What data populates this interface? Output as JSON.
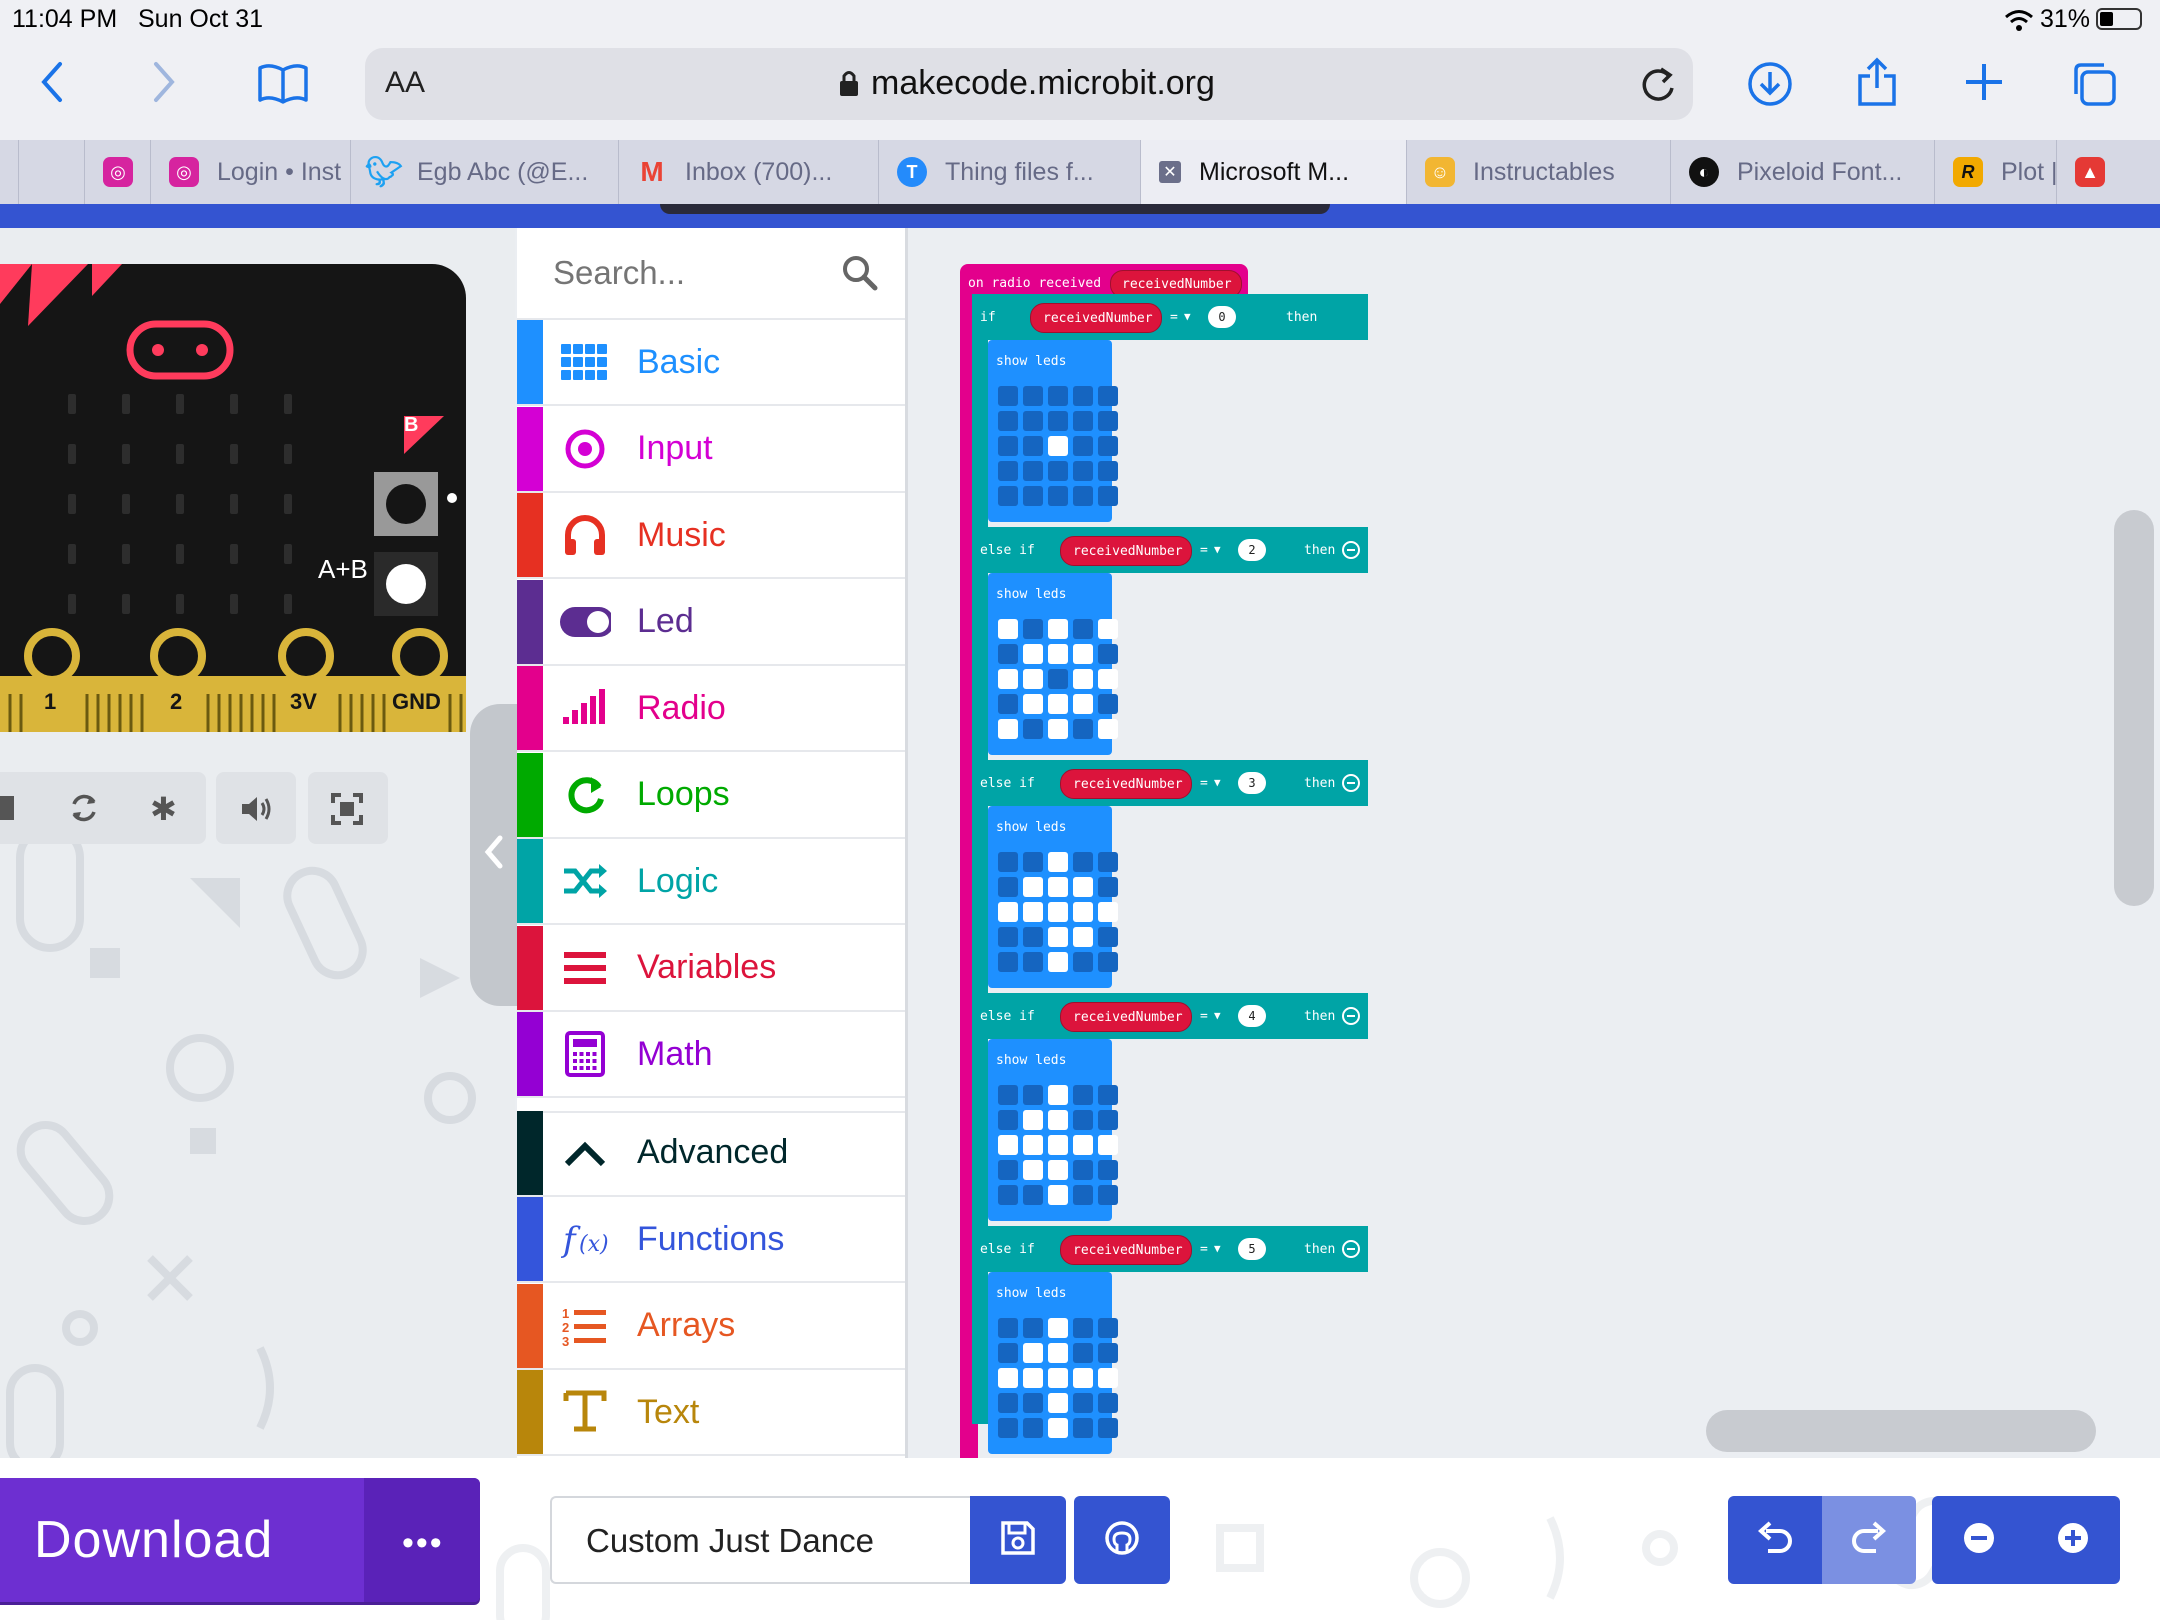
{
  "status": {
    "time": "11:04 PM",
    "date": "Sun Oct 31",
    "battery": "31%"
  },
  "browser": {
    "aa": "AA",
    "url": "makecode.microbit.org"
  },
  "tabs": [
    {
      "label": "Login • Inst",
      "icon": "instagram-icon",
      "color": "#d6249f"
    },
    {
      "label": "Egb Abc (@E...",
      "icon": "twitter-icon",
      "color": "#1da1f2"
    },
    {
      "label": "Inbox (700)...",
      "icon": "gmail-icon",
      "color": "#ea4335"
    },
    {
      "label": "Thing files f...",
      "icon": "thingiverse-icon",
      "color": "#248bfb"
    },
    {
      "label": "Microsoft M...",
      "icon": "makecode-icon",
      "color": "#6b6f8a"
    },
    {
      "label": "Instructables",
      "icon": "instructables-icon",
      "color": "#f2b632"
    },
    {
      "label": "Pixeloid Font...",
      "icon": "pixeloid-icon",
      "color": "#111111"
    },
    {
      "label": "Plot |",
      "icon": "plot-r-icon",
      "color": "#f2a900"
    }
  ],
  "simulator": {
    "pin1": "1",
    "pin2": "2",
    "pin3v": "3V",
    "pingnd": "GND",
    "buttonB": "B",
    "buttonAB": "A+B"
  },
  "toolbox": {
    "search_placeholder": "Search...",
    "categories": [
      {
        "label": "Basic",
        "color": "#1e90ff",
        "icon": "grid-icon"
      },
      {
        "label": "Input",
        "color": "#d400d4",
        "icon": "target-icon"
      },
      {
        "label": "Music",
        "color": "#e63022",
        "icon": "headphones-icon"
      },
      {
        "label": "Led",
        "color": "#5c2d91",
        "icon": "toggle-icon"
      },
      {
        "label": "Radio",
        "color": "#e3008c",
        "icon": "signal-icon"
      },
      {
        "label": "Loops",
        "color": "#00aa00",
        "icon": "loop-icon"
      },
      {
        "label": "Logic",
        "color": "#00a4a6",
        "icon": "shuffle-icon"
      },
      {
        "label": "Variables",
        "color": "#dc143c",
        "icon": "lines-icon"
      },
      {
        "label": "Math",
        "color": "#9400d3",
        "icon": "calculator-icon"
      }
    ],
    "advanced": {
      "label": "Advanced",
      "color": "#00272b"
    },
    "advanced_categories": [
      {
        "label": "Functions",
        "color": "#3455db",
        "icon": "function-icon"
      },
      {
        "label": "Arrays",
        "color": "#e65722",
        "icon": "list-icon"
      },
      {
        "label": "Text",
        "color": "#b8860b",
        "icon": "text-icon"
      }
    ]
  },
  "blocks": {
    "event_label": "on radio received",
    "param": "receivedNumber",
    "if_label": "if",
    "else_if_label": "else if",
    "then_label": "then",
    "op_label": "=",
    "show_leds": "show leds",
    "colors": {
      "radio": "#e3008c",
      "logic": "#00a4a6",
      "basic": "#1e90ff",
      "variable": "#dc143c"
    },
    "branches": [
      {
        "value": "0",
        "leds": [
          [
            0,
            0,
            0,
            0,
            0
          ],
          [
            0,
            0,
            0,
            0,
            0
          ],
          [
            0,
            0,
            1,
            0,
            0
          ],
          [
            0,
            0,
            0,
            0,
            0
          ],
          [
            0,
            0,
            0,
            0,
            0
          ]
        ]
      },
      {
        "value": "2",
        "leds": [
          [
            1,
            0,
            1,
            0,
            1
          ],
          [
            0,
            1,
            1,
            1,
            0
          ],
          [
            1,
            1,
            0,
            1,
            1
          ],
          [
            0,
            1,
            1,
            1,
            0
          ],
          [
            1,
            0,
            1,
            0,
            1
          ]
        ]
      },
      {
        "value": "3",
        "leds": [
          [
            0,
            0,
            1,
            0,
            0
          ],
          [
            0,
            1,
            1,
            1,
            0
          ],
          [
            1,
            1,
            1,
            1,
            1
          ],
          [
            0,
            0,
            1,
            1,
            0
          ],
          [
            0,
            0,
            1,
            0,
            0
          ]
        ]
      },
      {
        "value": "4",
        "leds": [
          [
            0,
            0,
            1,
            0,
            0
          ],
          [
            0,
            1,
            1,
            0,
            0
          ],
          [
            1,
            1,
            1,
            1,
            1
          ],
          [
            0,
            1,
            1,
            0,
            0
          ],
          [
            0,
            0,
            1,
            0,
            0
          ]
        ]
      },
      {
        "value": "5",
        "leds": [
          [
            0,
            0,
            1,
            0,
            0
          ],
          [
            0,
            1,
            1,
            0,
            0
          ],
          [
            1,
            1,
            1,
            1,
            1
          ],
          [
            0,
            0,
            1,
            0,
            0
          ],
          [
            0,
            0,
            1,
            0,
            0
          ]
        ]
      }
    ]
  },
  "footer": {
    "download_label": "Download",
    "project_name": "Custom Just Dance"
  }
}
